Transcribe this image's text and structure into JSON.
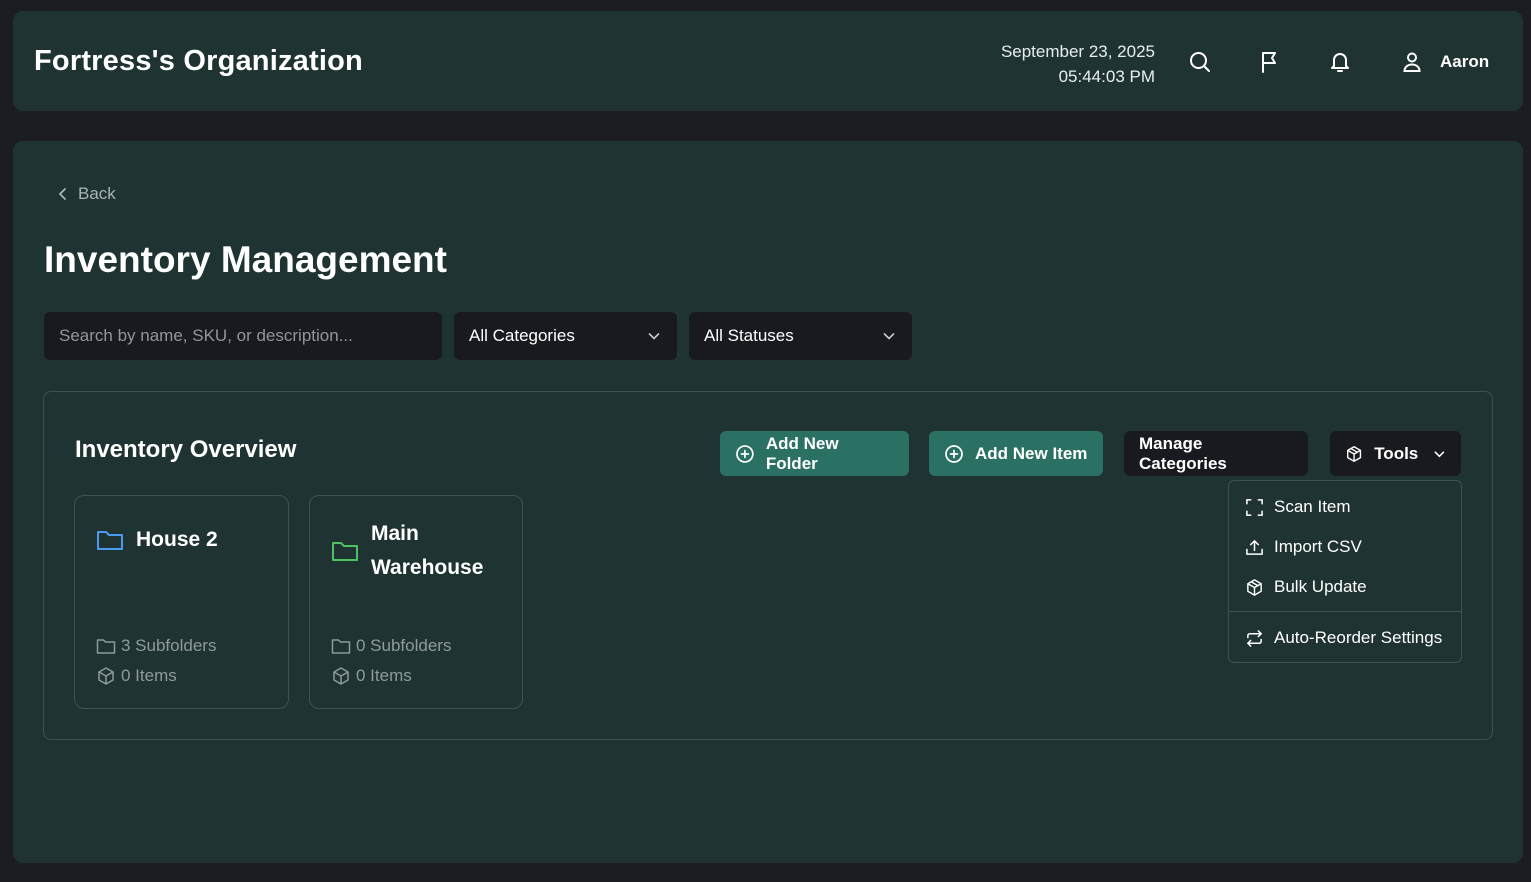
{
  "header": {
    "org_title": "Fortress's Organization",
    "date": "September 23, 2025",
    "time": "05:44:03 PM",
    "user_name": "Aaron"
  },
  "main": {
    "back_label": "Back",
    "page_title": "Inventory Management",
    "search_placeholder": "Search by name, SKU, or description...",
    "category_filter": "All Categories",
    "status_filter": "All Statuses"
  },
  "overview": {
    "title": "Inventory Overview",
    "add_folder_label": "Add New Folder",
    "add_item_label": "Add New Item",
    "manage_categories_label": "Manage Categories",
    "tools_label": "Tools",
    "folders": [
      {
        "name": "House 2",
        "subfolders": "3 Subfolders",
        "items": "0 Items",
        "icon_color": "#4a9bf0"
      },
      {
        "name": "Main Warehouse",
        "subfolders": "0 Subfolders",
        "items": "0 Items",
        "icon_color": "#4fc163"
      }
    ]
  },
  "tools_menu": {
    "items": [
      "Scan Item",
      "Import CSV",
      "Bulk Update",
      "Auto-Reorder Settings"
    ]
  },
  "colors": {
    "page_bg": "#1c1d22",
    "panel_bg": "#1f3333",
    "accent": "#2b7163",
    "input_bg": "#181a1f"
  }
}
